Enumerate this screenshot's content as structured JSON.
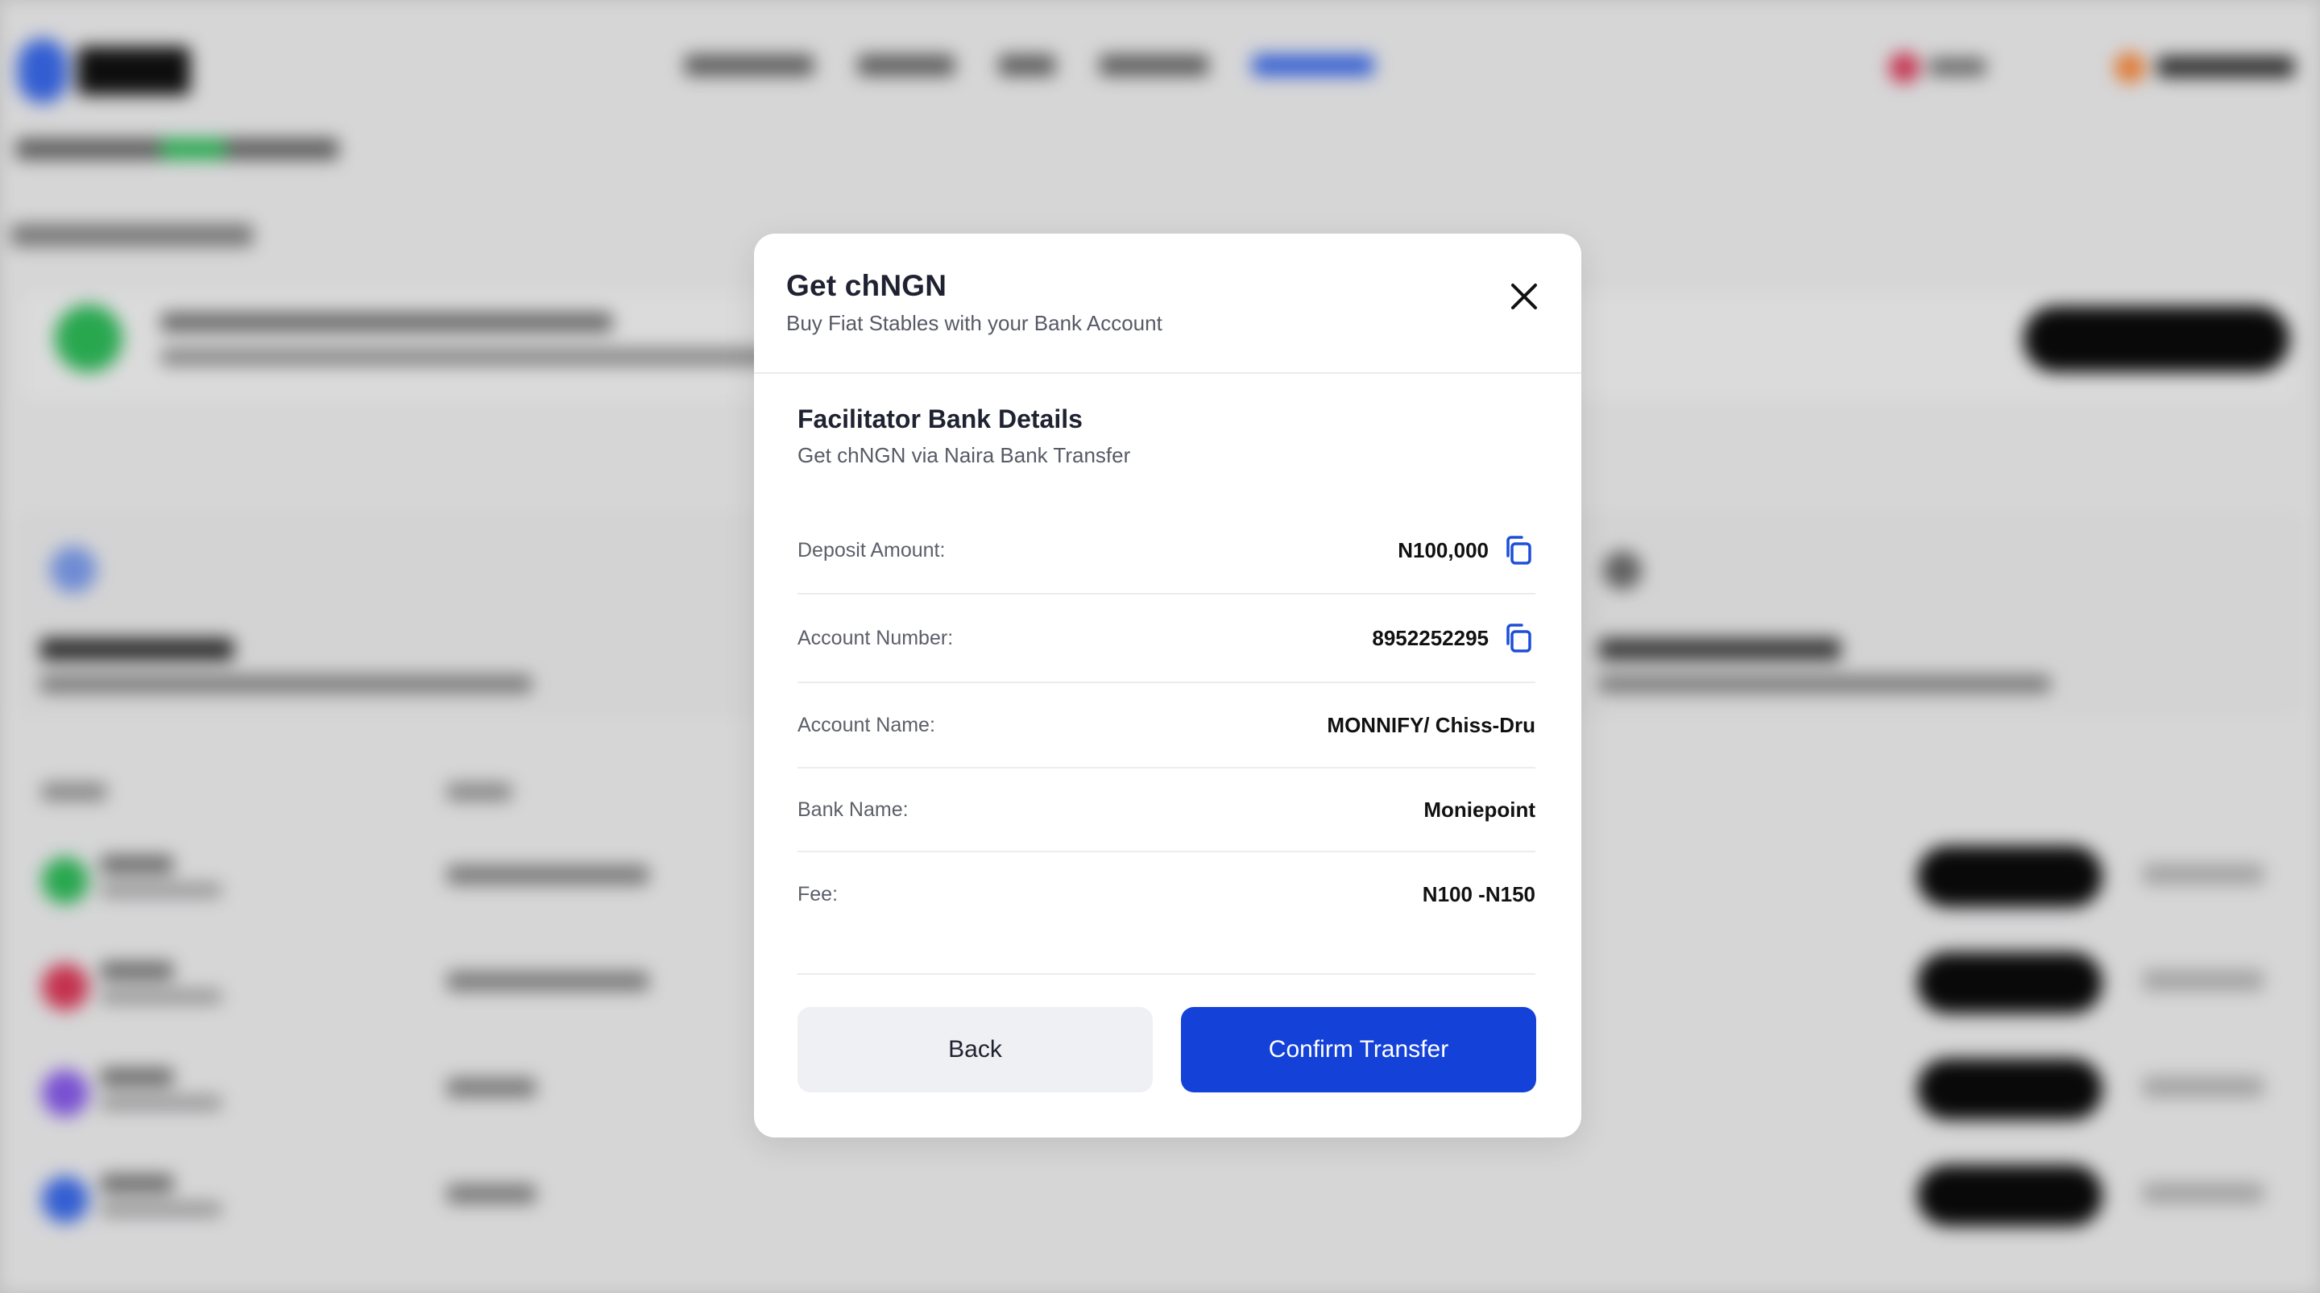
{
  "modal": {
    "title": "Get chNGN",
    "subtitle": "Buy Fiat Stables with your Bank Account",
    "section_title": "Facilitator Bank Details",
    "section_subtitle": "Get chNGN via Naira Bank Transfer",
    "details": [
      {
        "label": "Deposit Amount:",
        "value": "N100,000",
        "copyable": true
      },
      {
        "label": "Account Number:",
        "value": "8952252295",
        "copyable": true
      },
      {
        "label": "Account Name:",
        "value": "MONNIFY/ Chiss-Dru",
        "copyable": false
      },
      {
        "label": "Bank Name:",
        "value": "Moniepoint",
        "copyable": false
      },
      {
        "label": "Fee:",
        "value": "N100 -N150",
        "copyable": false
      }
    ],
    "back_label": "Back",
    "confirm_label": "Confirm Transfer"
  },
  "icons": {
    "close": "close-icon",
    "copy": "copy-icon"
  },
  "colors": {
    "accent": "#1441d8",
    "back_button_bg": "#eff0f3",
    "copy_icon": "#1d4ed8",
    "text_primary": "#1f2230",
    "text_secondary": "#575a66"
  }
}
